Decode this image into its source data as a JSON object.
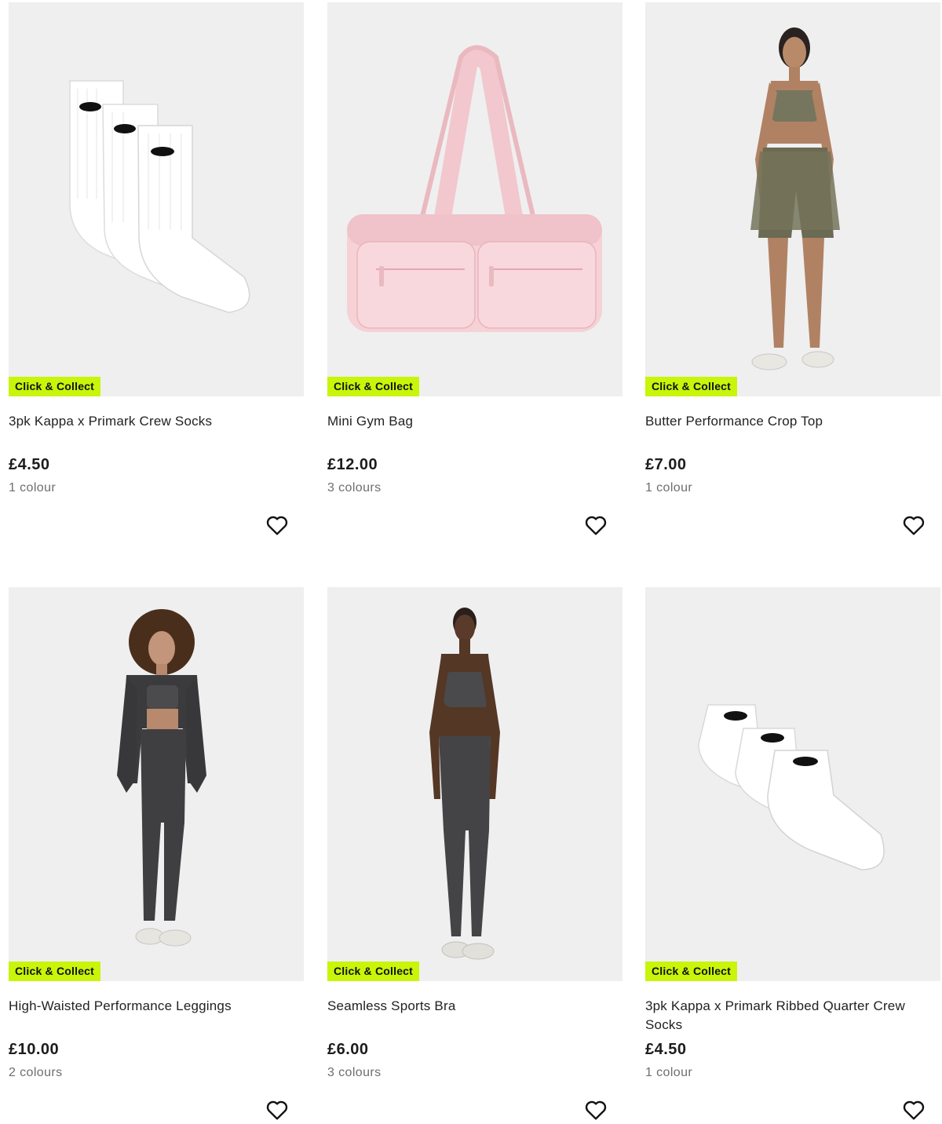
{
  "products": [
    {
      "badge": "Click & Collect",
      "title": "3pk Kappa x Primark Crew Socks",
      "price": "£4.50",
      "colours": "1 colour",
      "image": "white-crew-socks",
      "wishlist_icon": "heart-outline-icon"
    },
    {
      "badge": "Click & Collect",
      "title": "Mini Gym Bag",
      "price": "£12.00",
      "colours": "3 colours",
      "image": "pink-gym-bag",
      "wishlist_icon": "heart-outline-icon"
    },
    {
      "badge": "Click & Collect",
      "title": "Butter Performance Crop Top",
      "price": "£7.00",
      "colours": "1 colour",
      "image": "khaki-crop-top-model",
      "wishlist_icon": "heart-outline-icon"
    },
    {
      "badge": "Click & Collect",
      "title": "High-Waisted Performance Leggings",
      "price": "£10.00",
      "colours": "2 colours",
      "image": "charcoal-leggings-model",
      "wishlist_icon": "heart-outline-icon"
    },
    {
      "badge": "Click & Collect",
      "title": "Seamless Sports Bra",
      "price": "£6.00",
      "colours": "3 colours",
      "image": "charcoal-sports-bra-model",
      "wishlist_icon": "heart-outline-icon"
    },
    {
      "badge": "Click & Collect",
      "title": "3pk Kappa x Primark Ribbed Quarter Crew Socks",
      "price": "£4.50",
      "colours": "1 colour",
      "image": "white-quarter-socks",
      "wishlist_icon": "heart-outline-icon"
    }
  ],
  "colors": {
    "badge_bg": "#c8f50a",
    "image_bg": "#efeff0",
    "text": "#222222",
    "muted": "#6e6e6e"
  }
}
